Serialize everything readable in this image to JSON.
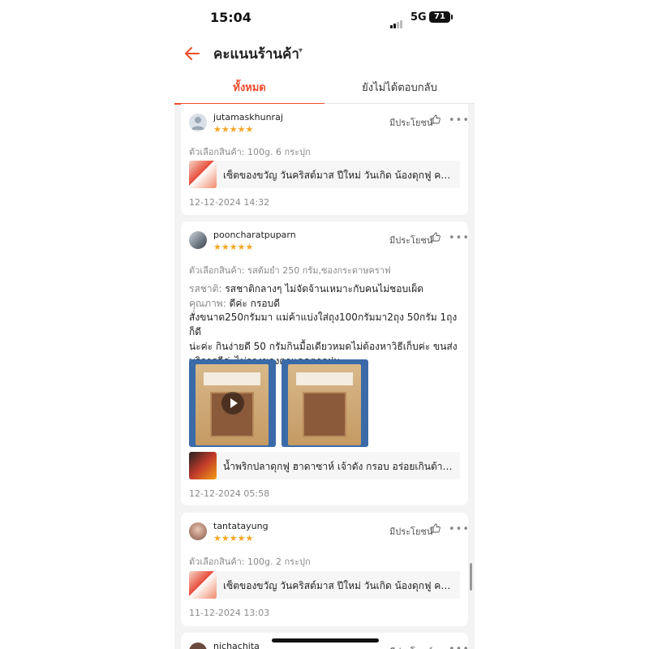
{
  "status_bar": {
    "time": "15:04",
    "network": "5G",
    "battery": "71"
  },
  "header": {
    "title": "คะแนนร้านค้า",
    "caret": "▾"
  },
  "tabs": [
    {
      "label": "ทั้งหมด"
    },
    {
      "label": "ยังไม่ได้ตอบกลับ"
    }
  ],
  "common": {
    "helpful_label": "มีประโยชน์",
    "stars": "★★★★★",
    "more": "•••"
  },
  "reviews": [
    {
      "username": "jutamaskhunraj",
      "variant": "ตัวเลือกสินค้า: 100g. 6 กระปุก",
      "product_name": "เซ็ตของขวัญ วันคริสต์มาส ปีใหม่ วันเกิด น้องดุกฟู คละรส",
      "date": "12-12-2024 14:32"
    },
    {
      "username": "pooncharatpuparn",
      "variant": "ตัวเลือกสินค้า: รสต้มยำ 250 กรัม,ซองกระดาษคราฟ",
      "taste_label": "รสชาติ:",
      "taste_value": "รสชาติกลางๆ ไม่จัดจ้านเหมาะกับคนไม่ชอบเผ็ด",
      "quality_label": "คุณภาพ:",
      "quality_value": "ดีค่ะ กรอบดี",
      "text_lines": [
        "สั่งขนาด250กรัมมา แม่ค้าแบ่งใส่ถุง100กรัมมา2ถุง 50กรัม 1ถุง ก็ดี",
        "น่ะค่ะ กินง่ายดี 50 กรัมกินมื้อเดียวหมดไม่ต้องหาวิธีเก็บค่ะ ขนส่ง",
        "บริการดีค่ะไม่วางของตาแดดตากฝน"
      ],
      "product_name": "น้ำพริกปลาดุกฟู ฮาดาซาห์ เจ้าดัง กรอบ อร่อยเกินต้าน รีวิวแน่น",
      "date": "12-12-2024 05:58"
    },
    {
      "username": "tantatayung",
      "variant": "ตัวเลือกสินค้า: 100g. 2 กระปุก",
      "product_name": "เซ็ตของขวัญ วันคริสต์มาส ปีใหม่ วันเกิด น้องดุกฟู คละรส",
      "date": "11-12-2024 13:03"
    },
    {
      "username": "nichachita"
    }
  ],
  "colors": {
    "accent": "#ee4d2d",
    "star": "#f5a623",
    "background": "#f3f3f3"
  }
}
